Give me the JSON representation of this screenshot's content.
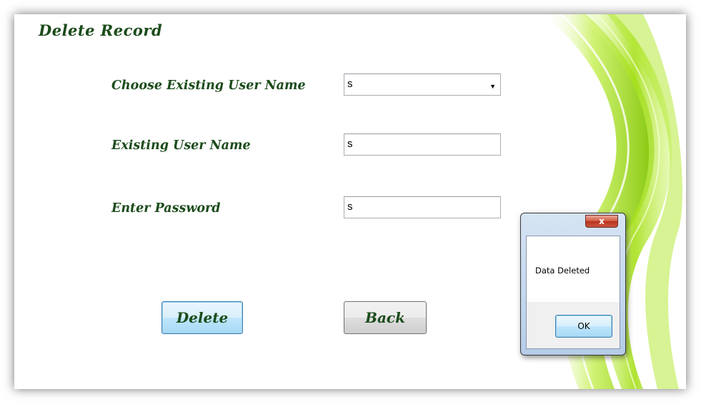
{
  "form": {
    "title": "Delete Record",
    "choose_label": "Choose Existing User Name",
    "choose_value": "s",
    "existing_label": "Existing User Name",
    "existing_value": "s",
    "password_label": "Enter Password",
    "password_value": "s",
    "delete_label": "Delete",
    "back_label": "Back",
    "dropdown_icon": "chevron-down-icon",
    "colors": {
      "label_text": "#1b4b1b",
      "swoosh": "#8fd100"
    }
  },
  "dialog": {
    "message": "Data Deleted",
    "close_label": "x",
    "ok_label": "OK"
  }
}
